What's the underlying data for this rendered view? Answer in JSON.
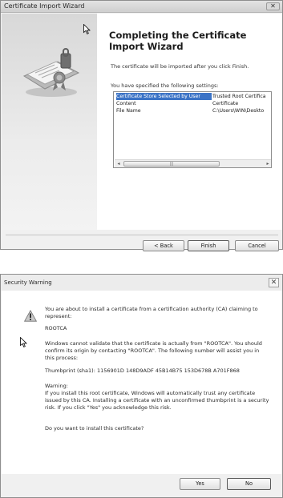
{
  "wizard": {
    "title": "Certificate Import Wizard",
    "close_label": "✕",
    "heading": "Completing the Certificate Import Wizard",
    "description": "The certificate will be imported after you click Finish.",
    "specified_label": "You have specified the following settings:",
    "settings": [
      {
        "name": "Certificate Store Selected by User",
        "value": "Trusted Root Certifica"
      },
      {
        "name": "Content",
        "value": "Certificate"
      },
      {
        "name": "File Name",
        "value": "C:\\Users\\WIN\\Deskto"
      }
    ],
    "scroll_thumb_glyph": "|||",
    "scroll_left": "◂",
    "scroll_right": "▸",
    "buttons": {
      "back": "< Back",
      "finish": "Finish",
      "cancel": "Cancel"
    }
  },
  "security": {
    "title": "Security Warning",
    "close_label": "✕",
    "intro": "You are about to install a certificate from a certification authority (CA) claiming to represent:",
    "ca_name": "ROOTCA",
    "validate": "Windows cannot validate that the certificate is actually from \"ROOTCA\". You should confirm its origin by contacting \"ROOTCA\". The following number will assist you in this process:",
    "thumbprint": "Thumbprint (sha1): 1156901D 148D9ADF 45B14B75 153D678B A701F868",
    "warning": "Warning:\nIf you install this root certificate, Windows will automatically trust any certificate issued by this CA. Installing a certificate with an unconfirmed thumbprint is a security risk. If you click \"Yes\" you acknowledge this risk.",
    "question": "Do you want to install this certificate?",
    "buttons": {
      "yes": "Yes",
      "no": "No"
    }
  },
  "colors": {
    "selection": "#3b73c6",
    "window_bg": "#f0f0f0",
    "warning_icon": "#f2c23a"
  }
}
